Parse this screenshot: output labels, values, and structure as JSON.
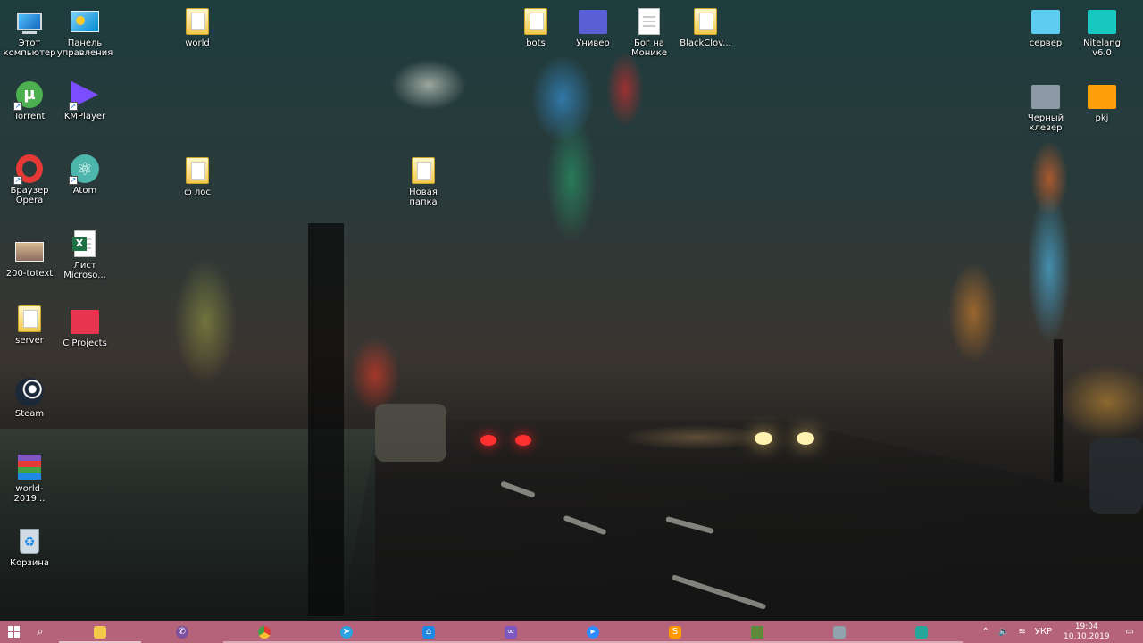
{
  "desktop": {
    "icons": {
      "this_pc": "Этот компьютер",
      "control_panel": "Панель управления",
      "world": "world",
      "bots": "bots",
      "univer": "Универ",
      "bog": "Бог на Монике",
      "blackclover": "BlackClov...",
      "server_ru": "сервер",
      "nitelang": "Nitelang v6.0",
      "torrent": "Torrent",
      "kmplayer": "KMPlayer",
      "chernyi_klever": "Черный клевер",
      "pkj": "pkj",
      "opera": "Браузер Opera",
      "atom": "Atom",
      "f_los": "ф лос",
      "novaya_papka": "Новая папка",
      "totext": "200-totext",
      "excel": "Лист Microso...",
      "server": "server",
      "c_projects": "C Projects",
      "steam": "Steam",
      "world2019": "world-2019...",
      "recycle": "Корзина"
    }
  },
  "taskbar": {
    "tray": {
      "language": "УКР",
      "time": "19:04",
      "date": "10.10.2019"
    },
    "apps": [
      {
        "name": "file-explorer",
        "color": "#f2c94c"
      },
      {
        "name": "viber",
        "color": "#7b519d"
      },
      {
        "name": "chrome",
        "color": "#4caf50"
      },
      {
        "name": "telegram",
        "color": "#2aa3e0"
      },
      {
        "name": "network-app",
        "color": "#1e88e5"
      },
      {
        "name": "visual-studio",
        "color": "#7e57c2"
      },
      {
        "name": "zoom",
        "color": "#2d8cff"
      },
      {
        "name": "sublime-text",
        "color": "#ff9800"
      },
      {
        "name": "minecraft",
        "color": "#5d8a3a"
      },
      {
        "name": "remote-desktop",
        "color": "#90a4ae"
      },
      {
        "name": "photos",
        "color": "#26a69a"
      }
    ]
  }
}
